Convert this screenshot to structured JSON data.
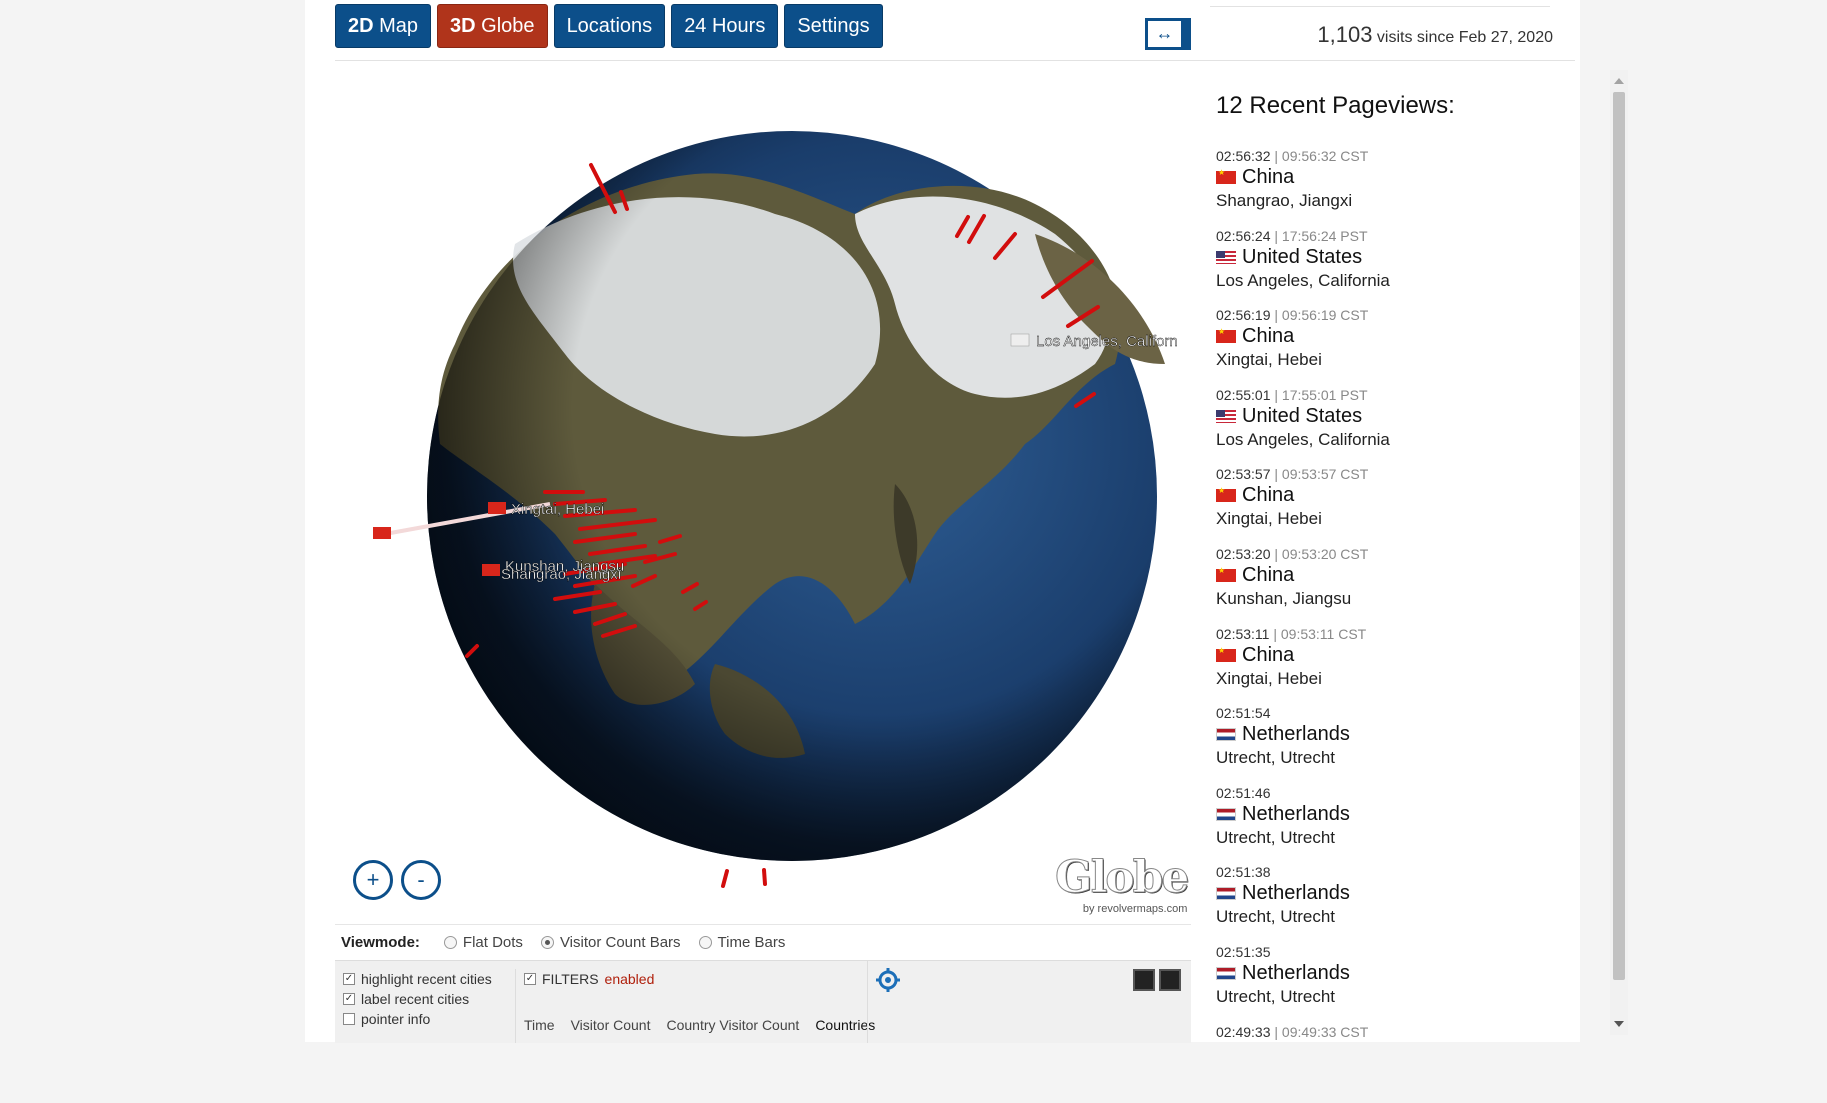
{
  "nav": {
    "buttons": [
      {
        "bold": "2D",
        "label": " Map"
      },
      {
        "bold": "3D",
        "label": " Globe"
      },
      {
        "label": "Locations"
      },
      {
        "label": "24 Hours"
      },
      {
        "label": "Settings"
      }
    ],
    "toggle_label": "↔"
  },
  "visits": {
    "count": "1,103",
    "text": " visits since Feb 27, 2020"
  },
  "globe": {
    "labels": {
      "la": "Los Angeles, Californ",
      "xingtai": "Xingtai, Hebei",
      "kunshan": "Kunshan, Jiangsu",
      "shangrao": "Shangrao, Jiangxi"
    },
    "zoom_in": "+",
    "zoom_out": "-",
    "logo": "Globe",
    "logo_sub": "by revolvermaps.com",
    "colors": {
      "ocean": "#1d3f6e",
      "marker": "#e01010",
      "snow": "#e9ecef",
      "land": "#5d5a3e"
    }
  },
  "viewmode": {
    "label": "Viewmode:",
    "options": [
      "Flat Dots",
      "Visitor Count Bars",
      "Time Bars"
    ],
    "selected": "Visitor Count Bars"
  },
  "options": {
    "highlight": "highlight recent cities",
    "label": "label recent cities",
    "pointer": "pointer info",
    "filters": "FILTERS",
    "filters_status": "enabled",
    "tabs": [
      "Time",
      "Visitor Count",
      "Country Visitor Count",
      "Countries"
    ]
  },
  "recent": {
    "title": "12 Recent Pageviews:",
    "items": [
      {
        "time": "02:56:32",
        "alt": " | 09:56:32 CST",
        "flag": "cn",
        "country": "China",
        "city": "Shangrao, Jiangxi"
      },
      {
        "time": "02:56:24",
        "alt": " | 17:56:24 PST",
        "flag": "us",
        "country": "United States",
        "city": "Los Angeles, California"
      },
      {
        "time": "02:56:19",
        "alt": " | 09:56:19 CST",
        "flag": "cn",
        "country": "China",
        "city": "Xingtai, Hebei"
      },
      {
        "time": "02:55:01",
        "alt": " | 17:55:01 PST",
        "flag": "us",
        "country": "United States",
        "city": "Los Angeles, California"
      },
      {
        "time": "02:53:57",
        "alt": " | 09:53:57 CST",
        "flag": "cn",
        "country": "China",
        "city": "Xingtai, Hebei"
      },
      {
        "time": "02:53:20",
        "alt": " | 09:53:20 CST",
        "flag": "cn",
        "country": "China",
        "city": "Kunshan, Jiangsu"
      },
      {
        "time": "02:53:11",
        "alt": " | 09:53:11 CST",
        "flag": "cn",
        "country": "China",
        "city": "Xingtai, Hebei"
      },
      {
        "time": "02:51:54",
        "alt": "",
        "flag": "nl",
        "country": "Netherlands",
        "city": "Utrecht, Utrecht"
      },
      {
        "time": "02:51:46",
        "alt": "",
        "flag": "nl",
        "country": "Netherlands",
        "city": "Utrecht, Utrecht"
      },
      {
        "time": "02:51:38",
        "alt": "",
        "flag": "nl",
        "country": "Netherlands",
        "city": "Utrecht, Utrecht"
      },
      {
        "time": "02:51:35",
        "alt": "",
        "flag": "nl",
        "country": "Netherlands",
        "city": "Utrecht, Utrecht"
      },
      {
        "time": "02:49:33",
        "alt": " | 09:49:33 CST",
        "flag": "cn",
        "country": "",
        "city": ""
      }
    ]
  }
}
